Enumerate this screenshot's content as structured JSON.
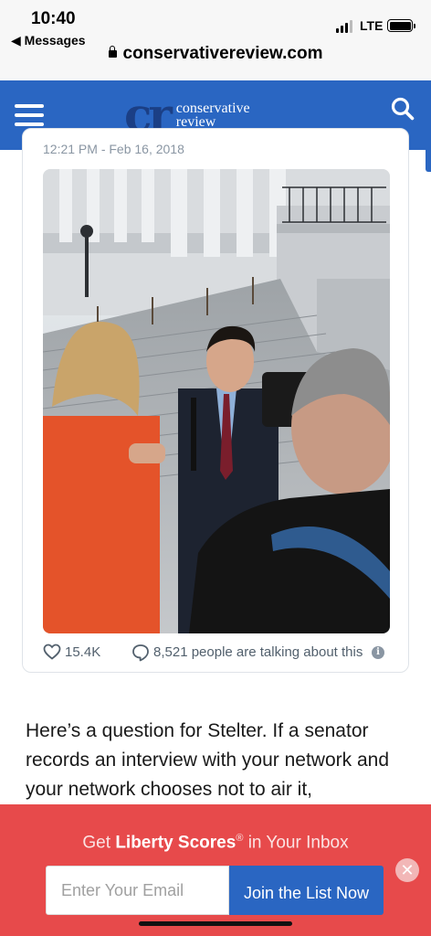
{
  "status_bar": {
    "time": "10:40",
    "back_label": "◀ Messages",
    "network": "LTE",
    "url": "conservativereview.com"
  },
  "header": {
    "logo_mark": "cr",
    "logo_line1": "conservative",
    "logo_line2": "review",
    "brand_color": "#2a66c2"
  },
  "tweet": {
    "timestamp": "12:21 PM - Feb 16, 2018",
    "likes": "15.4K",
    "talking": "8,521 people are talking about this",
    "info_glyph": "i"
  },
  "article": {
    "paragraph": "Here’s a question for Stelter. If a senator records an interview with your network and your network chooses not to air it,"
  },
  "signup": {
    "title_prefix": "Get ",
    "title_brand": "Liberty Scores",
    "title_reg": "®",
    "title_suffix": " in Your Inbox",
    "email_placeholder": "Enter Your Email",
    "button_label": "Join the List Now",
    "close_glyph": "✕",
    "banner_color": "#e74a4b"
  }
}
